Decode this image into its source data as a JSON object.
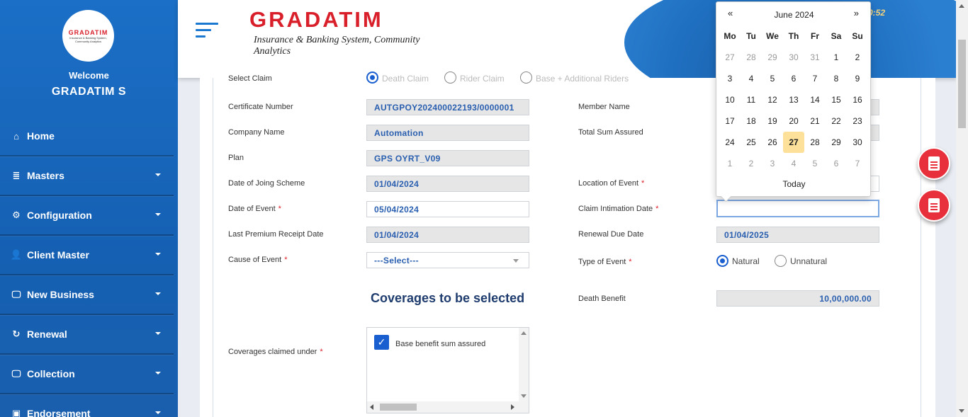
{
  "sidebar": {
    "logo_text": "GRADATIM",
    "welcome": "Welcome",
    "username": "GRADATIM S",
    "items": [
      {
        "label": "Home",
        "icon": "home-icon",
        "glyph": "⌂"
      },
      {
        "label": "Masters",
        "icon": "database-icon",
        "glyph": "≣"
      },
      {
        "label": "Configuration",
        "icon": "gears-icon",
        "glyph": "⚙"
      },
      {
        "label": "Client Master",
        "icon": "user-icon",
        "glyph": "👤"
      },
      {
        "label": "New Business",
        "icon": "monitor-icon",
        "glyph": "🖵"
      },
      {
        "label": "Renewal",
        "icon": "refresh-icon",
        "glyph": "↻"
      },
      {
        "label": "Collection",
        "icon": "monitor-icon",
        "glyph": "🖵"
      },
      {
        "label": "Endorsement",
        "icon": "briefcase-icon",
        "glyph": "▣"
      }
    ]
  },
  "header": {
    "brand_name": "GRADATIM",
    "brand_tagline": "Insurance & Banking System, Community Analytics",
    "clock": ":20:52"
  },
  "form": {
    "select_claim_label": "Select Claim",
    "claim_options": [
      "Death Claim",
      "Rider Claim",
      "Base + Additional Riders"
    ],
    "certificate_number": {
      "label": "Certificate Number",
      "value": "AUTGPOY202400022193/0000001"
    },
    "member_name": {
      "label": "Member Name"
    },
    "company_name": {
      "label": "Company Name",
      "value": "Automation"
    },
    "total_sum_assured": {
      "label": "Total Sum Assured"
    },
    "plan": {
      "label": "Plan",
      "value": "GPS OYRT_V09"
    },
    "date_joining": {
      "label": "Date of Joing Scheme",
      "value": "01/04/2024"
    },
    "location_event": {
      "label": "Location of Event",
      "required": "*"
    },
    "date_event": {
      "label": "Date of Event",
      "required": "*",
      "value": "05/04/2024"
    },
    "claim_intimation": {
      "label": "Claim Intimation Date",
      "required": "*",
      "value": ""
    },
    "last_premium": {
      "label": "Last Premium Receipt Date",
      "value": "01/04/2024"
    },
    "renewal_due": {
      "label": "Renewal Due Date",
      "value": "01/04/2025"
    },
    "cause_event": {
      "label": "Cause of Event",
      "required": "*",
      "value": "---Select---"
    },
    "type_event": {
      "label": "Type of Event",
      "required": "*",
      "options": [
        "Natural",
        "Unnatural"
      ],
      "selected": "Natural"
    },
    "coverages_title": "Coverages to be selected",
    "death_benefit": {
      "label": "Death Benefit",
      "value": "10,00,000.00"
    },
    "coverages_claimed": {
      "label": "Coverages claimed under",
      "required": "*",
      "items": [
        {
          "label": "Base benefit sum assured",
          "checked": true
        }
      ]
    }
  },
  "datepicker": {
    "title": "June 2024",
    "prev": "«",
    "next": "»",
    "weekdays": [
      "Mo",
      "Tu",
      "We",
      "Th",
      "Fr",
      "Sa",
      "Su"
    ],
    "weeks": [
      [
        "27",
        "28",
        "29",
        "30",
        "31",
        "1",
        "2"
      ],
      [
        "3",
        "4",
        "5",
        "6",
        "7",
        "8",
        "9"
      ],
      [
        "10",
        "11",
        "12",
        "13",
        "14",
        "15",
        "16"
      ],
      [
        "17",
        "18",
        "19",
        "20",
        "21",
        "22",
        "23"
      ],
      [
        "24",
        "25",
        "26",
        "27",
        "28",
        "29",
        "30"
      ],
      [
        "1",
        "2",
        "3",
        "4",
        "5",
        "6",
        "7"
      ]
    ],
    "highlighted": "27",
    "today_label": "Today"
  }
}
